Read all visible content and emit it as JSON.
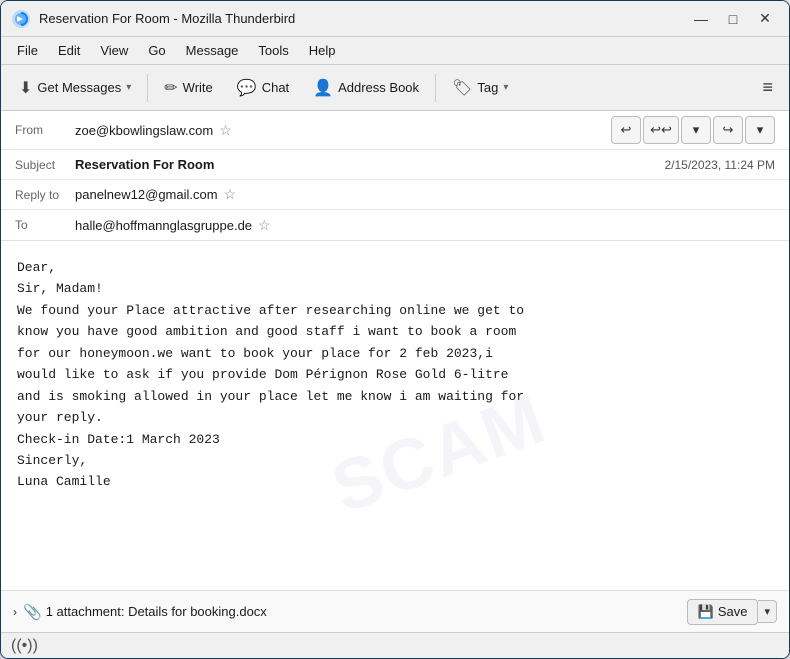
{
  "window": {
    "title": "Reservation For Room - Mozilla Thunderbird",
    "icon": "thunderbird-icon",
    "controls": {
      "minimize": "—",
      "maximize": "□",
      "close": "✕"
    }
  },
  "menubar": {
    "items": [
      "File",
      "Edit",
      "View",
      "Go",
      "Message",
      "Tools",
      "Help"
    ]
  },
  "toolbar": {
    "get_messages": "Get Messages",
    "write": "Write",
    "chat": "Chat",
    "address_book": "Address Book",
    "tag": "Tag",
    "tag_arrow": "▾"
  },
  "email": {
    "from_label": "From",
    "from_value": "zoe@kbowlingslaw.com",
    "subject_label": "Subject",
    "subject_value": "Reservation For Room",
    "date_value": "2/15/2023, 11:24 PM",
    "reply_to_label": "Reply to",
    "reply_to_value": "panelnew12@gmail.com",
    "to_label": "To",
    "to_value": "halle@hoffmannglasgruppe.de"
  },
  "body": {
    "text": "Dear,\nSir, Madam!\nWe found your Place attractive after researching online we get to\nknow you have good ambition and good staff i want to book a room\nfor our honeymoon.we want to book your place for 2 feb 2023,i\nwould like to ask if you provide Dom Pérignon Rose Gold 6-litre\nand is smoking allowed in your place let me know i am waiting for\nyour reply.\nCheck-in Date:1 March 2023\nSincerly,\nLuna Camille"
  },
  "attachment": {
    "count_label": "1 attachment: Details for booking.docx",
    "save_btn": "Save"
  },
  "statusbar": {
    "wifi_icon": "wifi-icon"
  }
}
